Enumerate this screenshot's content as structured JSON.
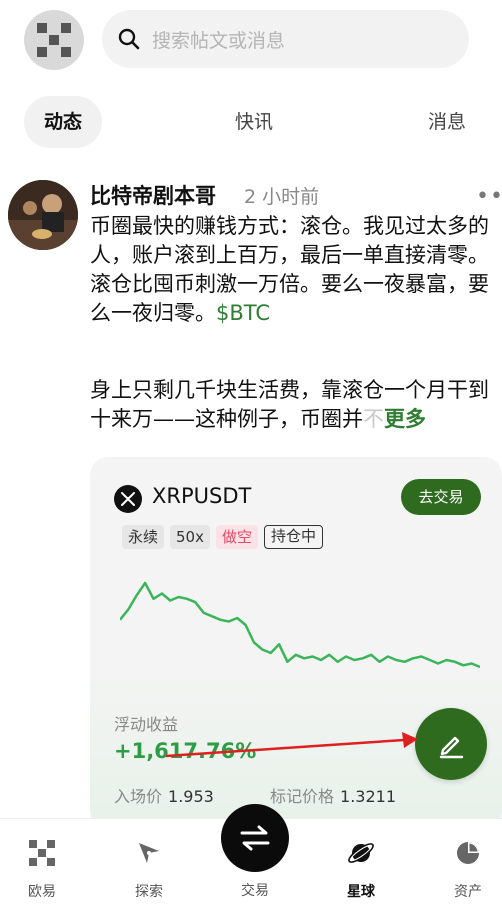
{
  "header": {
    "search_placeholder": "搜索帖文或消息"
  },
  "tabs": [
    {
      "label": "动态"
    },
    {
      "label": "快讯"
    },
    {
      "label": "消息"
    }
  ],
  "post": {
    "author": "比特帝剧本哥",
    "time": "2 小时前",
    "more": "•••",
    "text": "币圈最快的赚钱方式：滚仓。我见过太多的人，账户滚到上百万，最后一单直接清零。滚仓比囤币刺激一万倍。要么一夜暴富，要么一夜归零。",
    "tag": "$BTC",
    "para2_main": "身上只剩几千块生活费，靠滚仓一个月干到十来万——这种例子，币圈并",
    "para2_fade": "不",
    "more_link": "更多"
  },
  "card": {
    "symbol": "XRPUSDT",
    "trade_button": "去交易",
    "badges": [
      "永续",
      "50x",
      "做空",
      "持仓中"
    ],
    "pnl_label": "浮动收益",
    "pnl_value": "+1,617.76%",
    "entry_label": "入场价",
    "entry_value": "1.953",
    "mark_label": "标记价格",
    "mark_value": "1.3211"
  },
  "chart_data": {
    "type": "line",
    "series": [
      {
        "values": [
          58,
          64,
          72,
          79,
          70,
          73,
          69,
          71,
          70,
          68,
          62,
          60,
          58,
          57,
          59,
          55,
          45,
          41,
          39,
          44,
          34,
          38,
          36,
          37,
          35,
          38,
          34,
          37,
          35,
          36,
          38,
          34,
          37,
          35,
          34,
          36,
          37,
          35,
          33,
          35,
          34,
          32,
          33,
          31
        ]
      }
    ],
    "color": "#3cb55a"
  },
  "nav": [
    {
      "label": "欧易"
    },
    {
      "label": "探索"
    },
    {
      "label": "交易"
    },
    {
      "label": "星球"
    },
    {
      "label": "资产"
    }
  ],
  "colors": {
    "accent": "#2e6b1f",
    "profit": "#2e9c45",
    "short": "#e34b69",
    "arrow": "#e02020"
  }
}
